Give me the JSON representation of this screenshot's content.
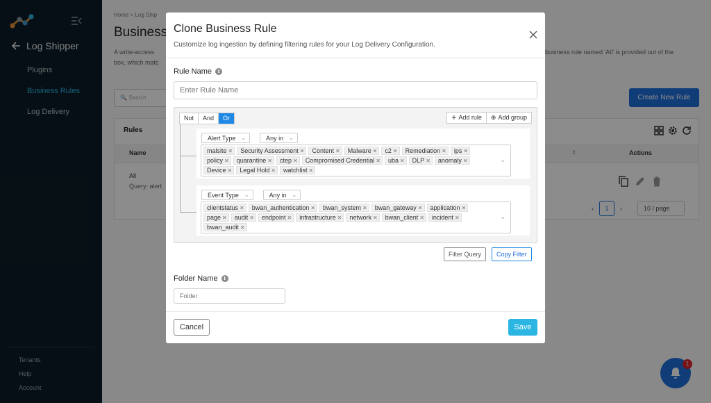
{
  "sidebar": {
    "app_title": "Log Shipper",
    "nav": [
      "Plugins",
      "Business Rules",
      "Log Delivery"
    ],
    "bottom": [
      "Tenants",
      "Help",
      "Account"
    ]
  },
  "page": {
    "breadcrumb": "Home > Log Ship",
    "title": "Business",
    "desc_line1": "A write-access",
    "desc_line1_right": "business rule named 'All' is provided out of the",
    "desc_line2": "box, which matc",
    "search_placeholder": "Search",
    "create_button": "Create New Rule",
    "rules_title": "Rules",
    "col_name": "Name",
    "col_actions": "Actions",
    "row_name": "All",
    "row_query": "Query: alert",
    "page_number": "1",
    "per_page": "10 / page",
    "notification_count": "1"
  },
  "modal": {
    "title": "Clone Business Rule",
    "subtitle": "Customize log ingestion by defining filtering rules for your Log Delivery Configuration.",
    "rule_name_label": "Rule Name",
    "rule_name_placeholder": "Enter Rule Name",
    "combinators": [
      "Not",
      "And",
      "Or"
    ],
    "selected_combinator": "Or",
    "add_rule": "Add rule",
    "add_group": "Add group",
    "rules": [
      {
        "field": "Alert Type",
        "operator": "Any in",
        "values": [
          "malsite",
          "Security Assessment",
          "Content",
          "Malware",
          "c2",
          "Remediation",
          "ips",
          "policy",
          "quarantine",
          "ctep",
          "Compromised Credential",
          "uba",
          "DLP",
          "anomaly",
          "Device",
          "Legal Hold",
          "watchlist"
        ]
      },
      {
        "field": "Event Type",
        "operator": "Any in",
        "values": [
          "clientstatus",
          "bwan_authentication",
          "bwan_system",
          "bwan_gateway",
          "application",
          "page",
          "audit",
          "endpoint",
          "infrastructure",
          "network",
          "bwan_client",
          "incident",
          "bwan_audit"
        ]
      }
    ],
    "filter_query_button": "Filter Query",
    "copy_filter_button": "Copy Filter",
    "folder_label": "Folder Name",
    "folder_placeholder": "Folder",
    "cancel_button": "Cancel",
    "save_button": "Save"
  },
  "colors": {
    "sidebar_bg": "#0c1d27",
    "active_nav": "#2bb5e3",
    "primary": "#1e6fd9",
    "save": "#2bb5e3"
  }
}
